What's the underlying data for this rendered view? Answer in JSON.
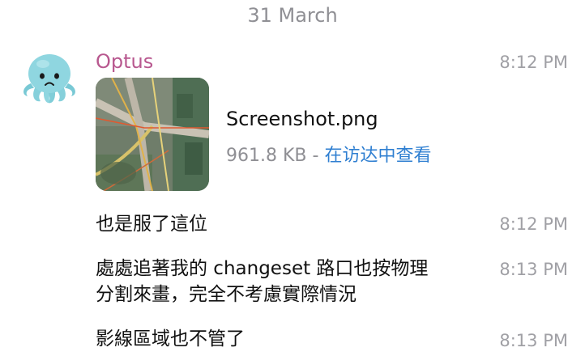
{
  "date_separator": "31 March",
  "sender": {
    "name": "Optus",
    "avatar_icon": "octopus-icon",
    "name_color": "#b8588f"
  },
  "messages": [
    {
      "type": "file",
      "time": "8:12 PM",
      "file_name": "Screenshot.png",
      "file_size": "961.8 KB",
      "separator": " - ",
      "open_label": "在访达中查看"
    },
    {
      "type": "text",
      "time": "8:12 PM",
      "lines": [
        "也是服了這位"
      ]
    },
    {
      "type": "text",
      "time": "8:13 PM",
      "lines": [
        "處處追著我的 changeset 路口也按物理",
        "分割來畫，完全不考慮實際情況"
      ]
    },
    {
      "type": "text",
      "time": "8:13 PM",
      "lines": [
        "影線區域也不管了"
      ]
    }
  ],
  "colors": {
    "link": "#2f7fd1",
    "timestamp": "#a0a0a5",
    "avatar": "#8fd6e0"
  }
}
